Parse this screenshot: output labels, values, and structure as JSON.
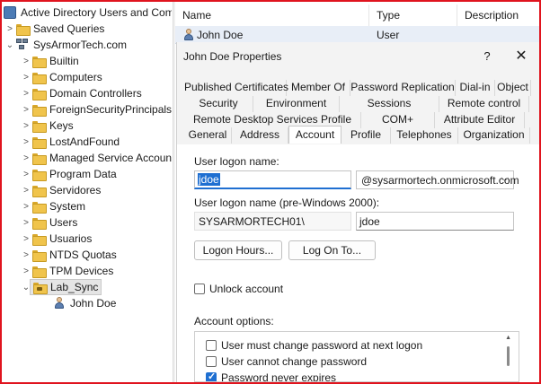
{
  "tree": {
    "root": "Active Directory Users and Com",
    "saved_queries": "Saved Queries",
    "domain": "SysArmorTech.com",
    "items": [
      {
        "label": "Builtin",
        "chev": ">"
      },
      {
        "label": "Computers",
        "chev": ">"
      },
      {
        "label": "Domain Controllers",
        "chev": ">"
      },
      {
        "label": "ForeignSecurityPrincipals",
        "chev": ">"
      },
      {
        "label": "Keys",
        "chev": ">"
      },
      {
        "label": "LostAndFound",
        "chev": ">"
      },
      {
        "label": "Managed Service Accoun",
        "chev": ">"
      },
      {
        "label": "Program Data",
        "chev": ">"
      },
      {
        "label": "Servidores",
        "chev": ">"
      },
      {
        "label": "System",
        "chev": ">"
      },
      {
        "label": "Users",
        "chev": ">"
      },
      {
        "label": "Usuarios",
        "chev": ">"
      },
      {
        "label": "NTDS Quotas",
        "chev": ">"
      },
      {
        "label": "TPM Devices",
        "chev": ">"
      }
    ],
    "lab_sync": "Lab_Sync",
    "child_user": "John Doe"
  },
  "list": {
    "columns": [
      "Name",
      "Type",
      "Description"
    ],
    "row": {
      "name": "John Doe",
      "type": "User"
    }
  },
  "dialog": {
    "title": "John Doe Properties",
    "help": "?",
    "close": "✕",
    "tabs_row1": [
      "Published Certificates",
      "Member Of",
      "Password Replication",
      "Dial-in",
      "Object"
    ],
    "tabs_row2": [
      "Security",
      "Environment",
      "Sessions",
      "Remote control"
    ],
    "tabs_row3": [
      "Remote Desktop Services Profile",
      "COM+",
      "Attribute Editor"
    ],
    "tabs_row4": [
      "General",
      "Address",
      "Account",
      "Profile",
      "Telephones",
      "Organization"
    ],
    "account": {
      "logon_name_label": "User logon name:",
      "logon_name_value": "jdoe",
      "upn_suffix": "@sysarmortech.onmicrosoft.com",
      "pre2000_label": "User logon name (pre-Windows 2000):",
      "pre2000_domain": "SYSARMORTECH01\\",
      "pre2000_value": "jdoe",
      "logon_hours_btn": "Logon Hours...",
      "logon_to_btn": "Log On To...",
      "unlock_label": "Unlock account",
      "options_label": "Account options:",
      "options": [
        {
          "label": "User must change password at next logon",
          "checked": false
        },
        {
          "label": "User cannot change password",
          "checked": false
        },
        {
          "label": "Password never expires",
          "checked": true
        }
      ]
    }
  }
}
